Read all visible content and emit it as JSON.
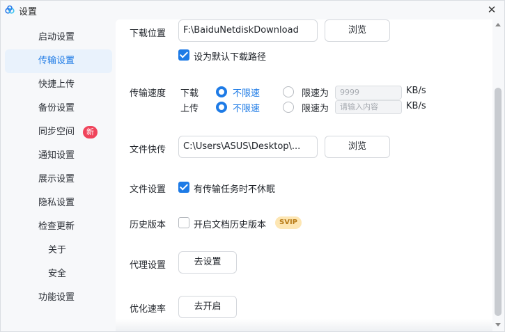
{
  "window": {
    "title": "设置",
    "close_glyph": "✕"
  },
  "sidebar": {
    "items": [
      {
        "label": "启动设置",
        "active": false
      },
      {
        "label": "传输设置",
        "active": true
      },
      {
        "label": "快捷上传",
        "active": false
      },
      {
        "label": "备份设置",
        "active": false
      },
      {
        "label": "同步空间",
        "active": false,
        "badge": "新"
      },
      {
        "label": "通知设置",
        "active": false
      },
      {
        "label": "展示设置",
        "active": false
      },
      {
        "label": "隐私设置",
        "active": false
      },
      {
        "label": "检查更新",
        "active": false
      },
      {
        "label": "关于",
        "active": false
      },
      {
        "label": "安全",
        "active": false
      },
      {
        "label": "功能设置",
        "active": false
      }
    ]
  },
  "download_location": {
    "label": "下载位置",
    "path": "F:\\BaiduNetdiskDownload",
    "browse_label": "浏览",
    "default_checkbox_label": "设为默认下载路径",
    "default_checked": true
  },
  "transfer_speed": {
    "label": "传输速度",
    "download": {
      "label": "下载",
      "unlimited_label": "不限速",
      "limit_label": "限速为",
      "selected": "unlimited",
      "limit_value": "9999",
      "unit": "KB/s"
    },
    "upload": {
      "label": "上传",
      "unlimited_label": "不限速",
      "limit_label": "限速为",
      "selected": "unlimited",
      "limit_placeholder": "请输入内容",
      "unit": "KB/s"
    }
  },
  "file_quick_transfer": {
    "label": "文件快传",
    "path": "C:\\Users\\ASUS\\Desktop\\...",
    "browse_label": "浏览"
  },
  "file_settings": {
    "label": "文件设置",
    "no_sleep_label": "有传输任务时不休眠",
    "no_sleep_checked": true
  },
  "history_version": {
    "label": "历史版本",
    "enable_label": "开启文档历史版本",
    "enable_checked": false,
    "badge": "SVIP"
  },
  "proxy": {
    "label": "代理设置",
    "button_label": "去设置"
  },
  "optimize_speed": {
    "label": "优化速率",
    "button_label": "去开启"
  },
  "colors": {
    "accent": "#1e7be6",
    "badge_red": "#f0445b",
    "svip_bg": "#fde6b3",
    "svip_text": "#b77a16"
  }
}
